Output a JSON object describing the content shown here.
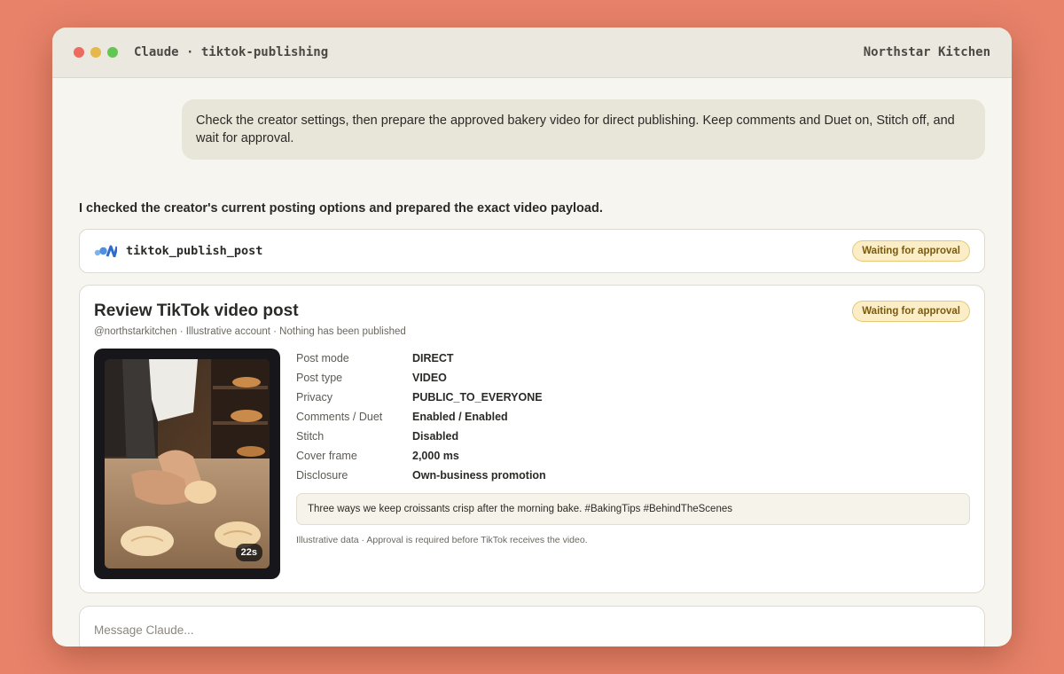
{
  "window": {
    "title": "Claude · tiktok-publishing",
    "workspace": "Northstar Kitchen"
  },
  "conversation": {
    "user_message": "Check the creator settings, then prepare the approved bakery video for direct publishing. Keep comments and Duet on, Stitch off, and wait for approval.",
    "assistant_message": "I checked the creator's current posting options and prepared the exact video payload."
  },
  "tool_call": {
    "name": "tiktok_publish_post",
    "status": "Waiting for approval",
    "icon": "claude-tool-icon"
  },
  "review": {
    "title": "Review TikTok video post",
    "subtitle": "@northstarkitchen · Illustrative account · Nothing has been published",
    "status": "Waiting for approval",
    "video": {
      "duration": "22s"
    },
    "fields": [
      {
        "label": "Post mode",
        "value": "DIRECT"
      },
      {
        "label": "Post type",
        "value": "VIDEO"
      },
      {
        "label": "Privacy",
        "value": "PUBLIC_TO_EVERYONE"
      },
      {
        "label": "Comments / Duet",
        "value": "Enabled / Enabled"
      },
      {
        "label": "Stitch",
        "value": "Disabled"
      },
      {
        "label": "Cover frame",
        "value": "2,000 ms"
      },
      {
        "label": "Disclosure",
        "value": "Own-business promotion"
      }
    ],
    "caption": "Three ways we keep croissants crisp after the morning bake. #BakingTips #BehindTheScenes",
    "note": "Illustrative data · Approval is required before TikTok receives the video."
  },
  "composer": {
    "placeholder": "Message Claude..."
  },
  "colors": {
    "background": "#e8836a",
    "badge_bg": "#fbeec6",
    "badge_text": "#7a5a10"
  }
}
